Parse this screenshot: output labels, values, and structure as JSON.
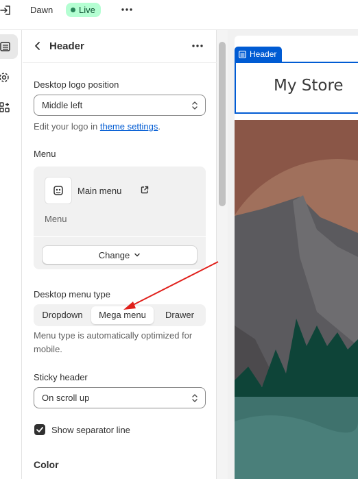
{
  "topbar": {
    "theme_name": "Dawn",
    "status_badge": "Live",
    "status_color": "#29845a"
  },
  "rail": {
    "items": [
      {
        "icon": "sections-icon",
        "active": true
      },
      {
        "icon": "settings-gear-icon",
        "active": false
      },
      {
        "icon": "apps-icon",
        "active": false
      }
    ]
  },
  "panel": {
    "title": "Header",
    "logo_position": {
      "label": "Desktop logo position",
      "value": "Middle left",
      "help_prefix": "Edit your logo in ",
      "help_link": "theme settings",
      "help_suffix": "."
    },
    "menu": {
      "label": "Menu",
      "name": "Main menu",
      "subtext": "Menu",
      "change_label": "Change"
    },
    "menu_type": {
      "label": "Desktop menu type",
      "options": [
        "Dropdown",
        "Mega menu",
        "Drawer"
      ],
      "selected": "Mega menu",
      "help": "Menu type is automatically optimized for mobile."
    },
    "sticky": {
      "label": "Sticky header",
      "value": "On scroll up"
    },
    "separator": {
      "label": "Show separator line",
      "checked": true
    },
    "color_heading": "Color"
  },
  "preview": {
    "section_tag": "Header",
    "store_name": "My Store",
    "accent_color": "#005bd3"
  },
  "annotation": {
    "arrow_color": "#e0201b"
  }
}
